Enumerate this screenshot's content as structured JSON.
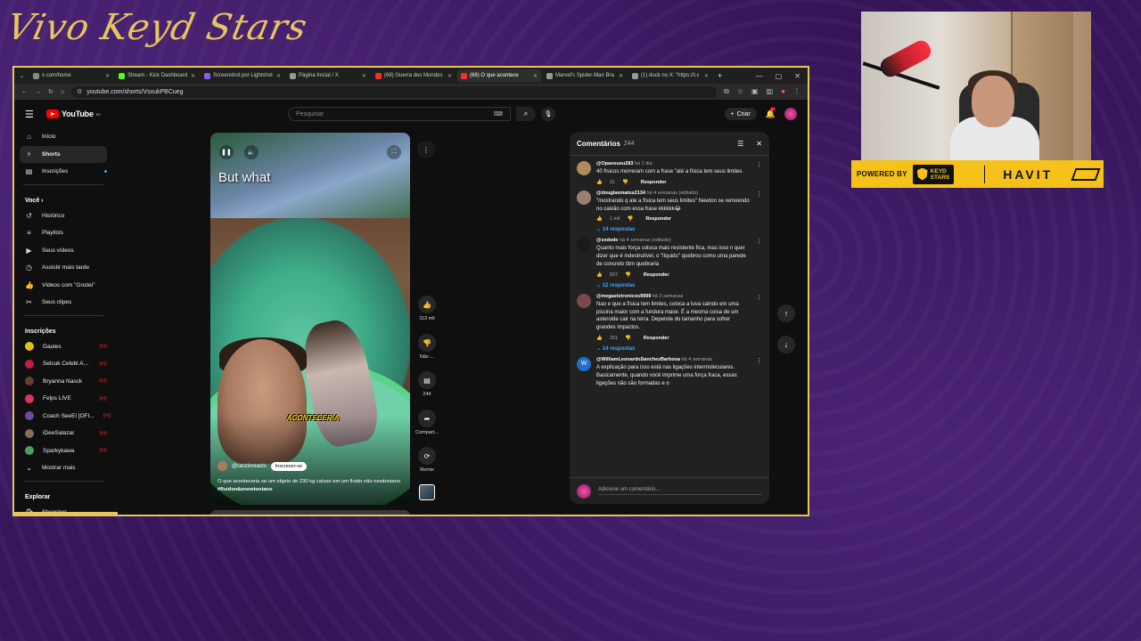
{
  "overlay": {
    "title": "Vivo Keyd Stars"
  },
  "browser": {
    "tabs": [
      {
        "label": "x.com/home",
        "color": "#888"
      },
      {
        "label": "Stream - Kick Dashboard",
        "color": "#53fc18"
      },
      {
        "label": "Screenshot por Lightshot",
        "color": "#8a5cf5"
      },
      {
        "label": "Página Inicial / X",
        "color": "#999"
      },
      {
        "label": "(68) Guerra dos Mundos",
        "color": "#ff2b2b"
      },
      {
        "label": "(68) O que acontece",
        "color": "#ff2b2b"
      },
      {
        "label": "Marvel's Spider-Man Bra",
        "color": "#999"
      },
      {
        "label": "(1) duck no X: \"https://t.c",
        "color": "#999"
      }
    ],
    "url": "youtube.com/shorts/VsxukPBCueg",
    "window_controls": [
      "—",
      "▢",
      "✕"
    ]
  },
  "youtube": {
    "logo_text": "YouTube",
    "logo_country": "BR",
    "search_placeholder": "Pesquisar",
    "create_label": "Criar",
    "bell_badge": "9+",
    "sidebar": {
      "main": [
        {
          "label": "Início",
          "icon": "⌂",
          "name": "home"
        },
        {
          "label": "Shorts",
          "icon": "⚡",
          "name": "shorts"
        },
        {
          "label": "Inscrições",
          "icon": "▤",
          "name": "subscriptions"
        }
      ],
      "you_header": "Você",
      "you": [
        {
          "label": "Histórico",
          "icon": "↺",
          "name": "history"
        },
        {
          "label": "Playlists",
          "icon": "≡",
          "name": "playlists"
        },
        {
          "label": "Seus vídeos",
          "icon": "▶",
          "name": "your-videos"
        },
        {
          "label": "Assistir mais tarde",
          "icon": "◷",
          "name": "watch-later"
        },
        {
          "label": "Vídeos com \"Gostei\"",
          "icon": "👍",
          "name": "liked-videos"
        },
        {
          "label": "Seus clipes",
          "icon": "✂",
          "name": "your-clips"
        }
      ],
      "subs_header": "Inscrições",
      "subs": [
        {
          "label": "Gaules",
          "color": "#e0c020"
        },
        {
          "label": "Selcuk Celebi A...",
          "color": "#c02040"
        },
        {
          "label": "Bryanna Nasck",
          "color": "#6a3b2a"
        },
        {
          "label": "Felps LIVE",
          "color": "#e0306a"
        },
        {
          "label": "Coach SeeEl [OFI...",
          "color": "#6a4aa0"
        },
        {
          "label": "iDeeSalazar",
          "color": "#8a6a5a"
        },
        {
          "label": "Sparkykawa",
          "color": "#4aa05a"
        }
      ],
      "show_more": "Mostrar mais",
      "explore_header": "Explorar",
      "explore": [
        {
          "label": "Shopping",
          "icon": "🛍"
        }
      ]
    },
    "short": {
      "caption_big": "But what",
      "sticker": "ACONTECERIA",
      "channel": "@ranzinreacts",
      "subscribe": "Inscrever-se",
      "description": "O que aconteceria se um objeto de 230 kg caísse em um fluido não newtoniano ",
      "hashtag": "#fluidonãonewtoniano"
    },
    "actions": {
      "likes": "113 mil",
      "dislike": "Não ...",
      "comments": "244",
      "share": "Compart...",
      "remix": "Remix"
    },
    "comments": {
      "title": "Comentários",
      "count": "244",
      "add_placeholder": "Adicione um comentário...",
      "reply_label": "Responder",
      "items": [
        {
          "author": "@Opasoueu283",
          "time": "há 1 dia",
          "text": "40 físicos morreram com a frase \"até a física tem seus limites",
          "likes": "31",
          "replies": "",
          "avatar": "#b08a5a"
        },
        {
          "author": "@douglasmatos2134",
          "time": "há 4 semanas (editado)",
          "text": "\"mostrando q ate a física tem seus limites\" Newton se remoendo no caixão com essa frase kkkkkk😂",
          "likes": "1 mil",
          "replies": "14 respostas",
          "avatar": "#9a8070"
        },
        {
          "author": "@xxdede",
          "time": "há 4 semanas (editado)",
          "text": "Quanto mais força coloca mais resistente fica, mas isso n quer dizer que é indestrutível, o \"líquido\" quebrou como uma parede de concreto tbm quebraria",
          "likes": "507",
          "replies": "12 respostas",
          "avatar": "#1a1a1a"
        },
        {
          "author": "@megaeletronicos9999",
          "time": "há 3 semanas",
          "text": "Nao e que a física tem limites, coloca a luva caindo em uma piscina maior com a fundura maior. É a mesma coisa de um asteroide cair na terra. Depende do tamanho para sofrer grandes impactos.",
          "likes": "201",
          "replies": "14 respostas",
          "avatar": "#7a4a4a"
        },
        {
          "author": "@WilliamLeonardoSanchezBarbosa",
          "time": "há 4 semanas",
          "text": "A explicação para isso está nas ligações intermoleculares. Basicamente, quando você imprime uma força fraca, essas ligações não são formadas e o",
          "likes": "",
          "replies": "",
          "avatar": "#1e6fd0",
          "initial": "W"
        }
      ]
    }
  },
  "sponsor": {
    "powered": "POWERED BY",
    "keyd_top": "KEYD",
    "keyd_bottom": "STARS",
    "brand": "HAVIT"
  }
}
